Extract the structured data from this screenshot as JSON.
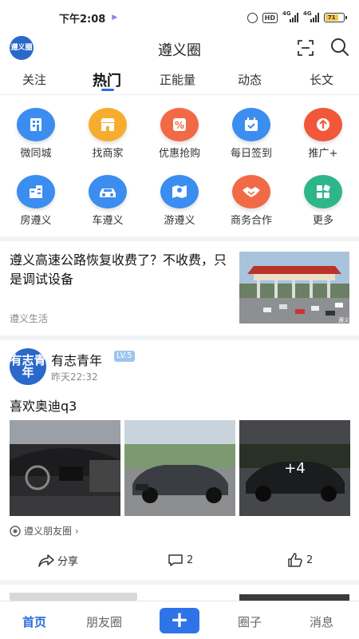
{
  "status": {
    "time": "下午2:08",
    "net1": "4G",
    "net2": "4G",
    "battery": "71",
    "hd": "HD"
  },
  "app": {
    "title": "遵义圈",
    "logo_text": "遵义圈"
  },
  "tabs": [
    {
      "label": "关注"
    },
    {
      "label": "热门"
    },
    {
      "label": "正能量"
    },
    {
      "label": "动态"
    },
    {
      "label": "长文"
    }
  ],
  "grid": [
    {
      "label": "微同城",
      "color": "#3c8df0",
      "icon": "building-icon"
    },
    {
      "label": "找商家",
      "color": "#f6ad2e",
      "icon": "shop-icon"
    },
    {
      "label": "优惠抢购",
      "color": "#f26a45",
      "icon": "discount-icon"
    },
    {
      "label": "每日签到",
      "color": "#3c8df0",
      "icon": "calendar-check-icon"
    },
    {
      "label": "推广+",
      "color": "#f2573a",
      "icon": "promote-icon"
    },
    {
      "label": "房遵义",
      "color": "#3c8df0",
      "icon": "house-icon"
    },
    {
      "label": "车遵义",
      "color": "#3c8df0",
      "icon": "car-icon"
    },
    {
      "label": "游遵义",
      "color": "#3c8df0",
      "icon": "map-pin-icon"
    },
    {
      "label": "商务合作",
      "color": "#f26a45",
      "icon": "handshake-icon"
    },
    {
      "label": "更多",
      "color": "#2fb58a",
      "icon": "grid-more-icon"
    }
  ],
  "article": {
    "title": "遵义高速公路恢复收费了？不收费，只是调试设备",
    "source": "遵义生活",
    "thumb_watermark": "遵义"
  },
  "post": {
    "avatar_text": "有志青年",
    "username": "有志青年",
    "level": "LV.5",
    "time": "昨天22:32",
    "text": "喜欢奥迪q3",
    "more_images": "+4",
    "circle": "遵义朋友圈",
    "share_label": "分享",
    "comment_count": "2",
    "like_count": "2"
  },
  "bottom_nav": {
    "home": "首页",
    "moments": "朋友圈",
    "circle": "圈子",
    "messages": "消息",
    "plus": "+"
  },
  "colors": {
    "accent": "#2e6fde",
    "plus_button": "#2e73e8",
    "level_badge": "#9ec5ee"
  }
}
